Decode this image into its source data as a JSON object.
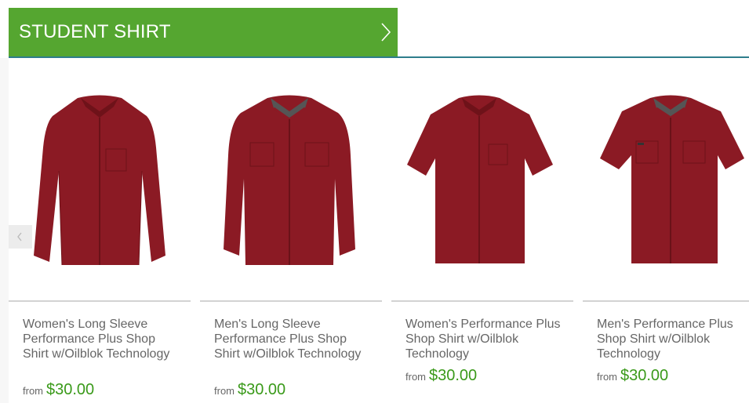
{
  "section": {
    "title": "STUDENT SHIRT",
    "arrow_icon": "chevron-right-icon"
  },
  "carousel": {
    "prev_icon": "chevron-left-icon"
  },
  "products": [
    {
      "name": "Women's Long Sleeve Performance Plus Shop Shirt w/Oilblok Technology",
      "price_prefix": "from",
      "price": "$30.00",
      "image": "womens-long-sleeve-shirt"
    },
    {
      "name": "Men's Long Sleeve Performance Plus Shop Shirt w/Oilblok Technology",
      "price_prefix": "from",
      "price": "$30.00",
      "image": "mens-long-sleeve-shirt"
    },
    {
      "name": "Women's Performance Plus Shop Shirt w/Oilblok Technology",
      "price_prefix": "from",
      "price": "$30.00",
      "image": "womens-short-sleeve-shirt"
    },
    {
      "name": "Men's Performance Plus Shop Shirt w/Oilblok Technology",
      "price_prefix": "from",
      "price": "$30.00",
      "image": "mens-short-sleeve-shirt"
    }
  ],
  "colors": {
    "header_green": "#55a630",
    "price_green": "#3a9a1a",
    "shirt_red": "#8b1a24",
    "rule_teal": "#2e7d8c"
  }
}
